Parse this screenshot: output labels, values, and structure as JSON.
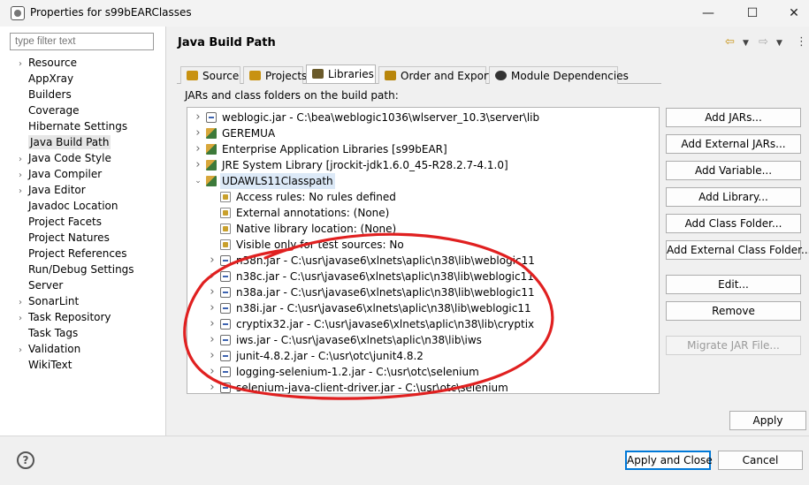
{
  "window": {
    "title": "Properties for s99bEARClasses"
  },
  "filter": {
    "placeholder": "type filter text"
  },
  "nav": [
    {
      "label": "Resource",
      "expandable": true
    },
    {
      "label": "AppXray",
      "expandable": false
    },
    {
      "label": "Builders",
      "expandable": false
    },
    {
      "label": "Coverage",
      "expandable": false
    },
    {
      "label": "Hibernate Settings",
      "expandable": false
    },
    {
      "label": "Java Build Path",
      "expandable": false,
      "selected": true
    },
    {
      "label": "Java Code Style",
      "expandable": true
    },
    {
      "label": "Java Compiler",
      "expandable": true
    },
    {
      "label": "Java Editor",
      "expandable": true
    },
    {
      "label": "Javadoc Location",
      "expandable": false
    },
    {
      "label": "Project Facets",
      "expandable": false
    },
    {
      "label": "Project Natures",
      "expandable": false
    },
    {
      "label": "Project References",
      "expandable": false
    },
    {
      "label": "Run/Debug Settings",
      "expandable": false
    },
    {
      "label": "Server",
      "expandable": false
    },
    {
      "label": "SonarLint",
      "expandable": true
    },
    {
      "label": "Task Repository",
      "expandable": true
    },
    {
      "label": "Task Tags",
      "expandable": false
    },
    {
      "label": "Validation",
      "expandable": true
    },
    {
      "label": "WikiText",
      "expandable": false
    }
  ],
  "page": {
    "title": "Java Build Path",
    "subtitle": "JARs and class folders on the build path:"
  },
  "tabs": [
    {
      "label": "Source",
      "icon": "source-folder-icon"
    },
    {
      "label": "Projects",
      "icon": "projects-folder-icon"
    },
    {
      "label": "Libraries",
      "icon": "libraries-icon",
      "active": true
    },
    {
      "label": "Order and Export",
      "icon": "order-export-icon"
    },
    {
      "label": "Module Dependencies",
      "icon": "module-icon"
    }
  ],
  "tree": [
    {
      "label": "weblogic.jar - C:\\bea\\weblogic1036\\wlserver_10.3\\server\\lib",
      "icon": "jar-icon",
      "level": 0,
      "twisty": ">"
    },
    {
      "label": "GEREMUA",
      "icon": "library-icon",
      "level": 0,
      "twisty": ">"
    },
    {
      "label": "Enterprise Application Libraries [s99bEAR]",
      "icon": "library-icon",
      "level": 0,
      "twisty": ">"
    },
    {
      "label": "JRE System Library [jrockit-jdk1.6.0_45-R28.2.7-4.1.0]",
      "icon": "library-icon",
      "level": 0,
      "twisty": ">"
    },
    {
      "label": "UDAWLS11Classpath",
      "icon": "library-icon",
      "level": 0,
      "twisty": "v",
      "selected": true
    },
    {
      "label": "Access rules: No rules defined",
      "icon": "access-rules-icon",
      "level": 1,
      "twisty": ""
    },
    {
      "label": "External annotations: (None)",
      "icon": "annotations-icon",
      "level": 1,
      "twisty": ""
    },
    {
      "label": "Native library location: (None)",
      "icon": "native-library-icon",
      "level": 1,
      "twisty": ""
    },
    {
      "label": "Visible only for test sources: No",
      "icon": "test-sources-icon",
      "level": 1,
      "twisty": ""
    },
    {
      "label": "n38n.jar - C:\\usr\\javase6\\xlnets\\aplic\\n38\\lib\\weblogic11",
      "icon": "jar-icon",
      "level": 1,
      "twisty": ">"
    },
    {
      "label": "n38c.jar - C:\\usr\\javase6\\xlnets\\aplic\\n38\\lib\\weblogic11",
      "icon": "jar-icon",
      "level": 1,
      "twisty": ">"
    },
    {
      "label": "n38a.jar - C:\\usr\\javase6\\xlnets\\aplic\\n38\\lib\\weblogic11",
      "icon": "jar-icon",
      "level": 1,
      "twisty": ">"
    },
    {
      "label": "n38i.jar - C:\\usr\\javase6\\xlnets\\aplic\\n38\\lib\\weblogic11",
      "icon": "jar-icon",
      "level": 1,
      "twisty": ">"
    },
    {
      "label": "cryptix32.jar - C:\\usr\\javase6\\xlnets\\aplic\\n38\\lib\\cryptix",
      "icon": "jar-icon",
      "level": 1,
      "twisty": ">"
    },
    {
      "label": "iws.jar - C:\\usr\\javase6\\xlnets\\aplic\\n38\\lib\\iws",
      "icon": "jar-icon",
      "level": 1,
      "twisty": ">"
    },
    {
      "label": "junit-4.8.2.jar - C:\\usr\\otc\\junit4.8.2",
      "icon": "jar-icon",
      "level": 1,
      "twisty": ">"
    },
    {
      "label": "logging-selenium-1.2.jar - C:\\usr\\otc\\selenium",
      "icon": "jar-icon",
      "level": 1,
      "twisty": ">"
    },
    {
      "label": "selenium-java-client-driver.jar - C:\\usr\\otc\\selenium",
      "icon": "jar-icon",
      "level": 1,
      "twisty": ">"
    }
  ],
  "buttons": {
    "add_jars": "Add JARs...",
    "add_external_jars": "Add External JARs...",
    "add_variable": "Add Variable...",
    "add_library": "Add Library...",
    "add_class_folder": "Add Class Folder...",
    "add_external_class_folder": "Add External Class Folder...",
    "edit": "Edit...",
    "remove": "Remove",
    "migrate_jar": "Migrate JAR File...",
    "apply": "Apply",
    "apply_and_close": "Apply and Close",
    "cancel": "Cancel"
  },
  "colors": {
    "accent": "#0078d7",
    "annotation": "#e02020",
    "selection": "#dce9f7"
  }
}
